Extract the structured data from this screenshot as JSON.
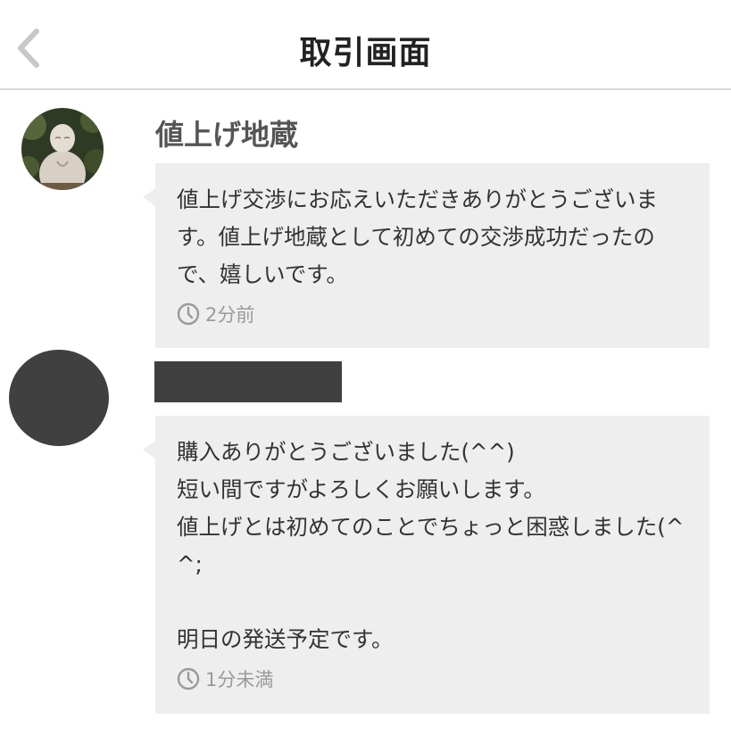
{
  "header": {
    "title": "取引画面",
    "back_icon": "chevron-left-icon"
  },
  "messages": [
    {
      "sender": "値上げ地蔵",
      "avatar": "jizo-statue-photo",
      "text": "値上げ交渉にお応えいただきありがとうございます。値上げ地蔵として初めての交渉成功だったので、嬉しいです。",
      "time": "2分前"
    },
    {
      "sender": "",
      "avatar": "redacted-avatar",
      "text": "購入ありがとうございました(^^)\n短い間ですがよろしくお願いします。\n値上げとは初めてのことでちょっと困惑しました(^^;\n\n明日の発送予定です。",
      "time": "1分未満"
    }
  ],
  "colors": {
    "bubble": "#eeeeee",
    "redacted": "#404040",
    "meta_text": "#9a9a9a"
  }
}
